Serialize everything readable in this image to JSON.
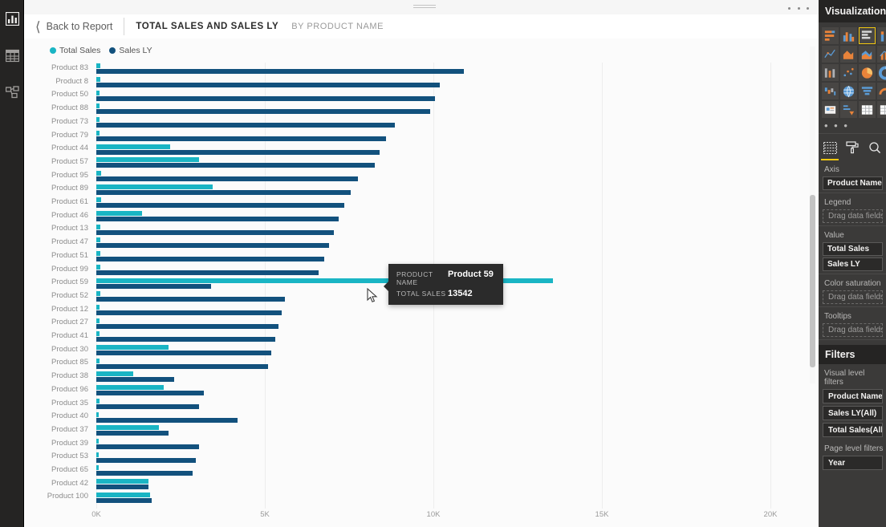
{
  "nav_rail": {
    "items": [
      {
        "name": "report-view",
        "icon": "bar-chart-icon",
        "active": true
      },
      {
        "name": "data-view",
        "icon": "table-grid-icon",
        "active": false
      },
      {
        "name": "model-view",
        "icon": "relationships-icon",
        "active": false
      }
    ]
  },
  "header": {
    "back_label": "Back to Report",
    "title": "TOTAL SALES AND SALES LY",
    "subtitle": "BY PRODUCT NAME",
    "overflow_menu": "…"
  },
  "legend": {
    "items": [
      {
        "label": "Total Sales",
        "color": "#1ab5c4"
      },
      {
        "label": "Sales LY",
        "color": "#12517d"
      }
    ]
  },
  "tooltip": {
    "key1": "PRODUCT NAME",
    "val1": "Product 59",
    "key2": "TOTAL SALES",
    "val2": "13542"
  },
  "right_panel": {
    "viz_title": "Visualizations",
    "more_glyph": "• • •",
    "tabs": [
      {
        "name": "fields-tab",
        "icon": "fields-icon",
        "active": true
      },
      {
        "name": "format-tab",
        "icon": "paint-roller-icon",
        "active": false
      },
      {
        "name": "analytics-tab",
        "icon": "magnifier-icon",
        "active": false
      }
    ],
    "wells": [
      {
        "label": "Axis",
        "chips": [
          "Product Name"
        ],
        "placeholder": null
      },
      {
        "label": "Legend",
        "chips": [],
        "placeholder": "Drag data fields here"
      },
      {
        "label": "Value",
        "chips": [
          "Total Sales",
          "Sales LY"
        ],
        "placeholder": null
      },
      {
        "label": "Color saturation",
        "chips": [],
        "placeholder": "Drag data fields here"
      },
      {
        "label": "Tooltips",
        "chips": [],
        "placeholder": "Drag data fields here"
      }
    ],
    "filters_title": "Filters",
    "visual_level_label": "Visual level filters",
    "visual_level_filters": [
      "Product Name(All)",
      "Sales LY(All)",
      "Total Sales(All)"
    ],
    "page_level_label": "Page level filters",
    "page_level_filters": [
      "Year"
    ]
  },
  "chart_data": {
    "type": "bar",
    "orientation": "horizontal",
    "title": "TOTAL SALES AND SALES LY",
    "subtitle": "BY PRODUCT NAME",
    "xlabel": "",
    "ylabel": "",
    "xlim": [
      0,
      21000
    ],
    "ticks": [
      {
        "label": "0K",
        "value": 0
      },
      {
        "label": "5K",
        "value": 5000
      },
      {
        "label": "10K",
        "value": 10000
      },
      {
        "label": "15K",
        "value": 15000
      },
      {
        "label": "20K",
        "value": 20000
      }
    ],
    "grid": true,
    "legend_position": "top-left",
    "highlighted_category": "Product 59",
    "categories": [
      "Product 83",
      "Product 8",
      "Product 50",
      "Product 88",
      "Product 73",
      "Product 79",
      "Product 44",
      "Product 57",
      "Product 95",
      "Product 89",
      "Product 61",
      "Product 46",
      "Product 13",
      "Product 47",
      "Product 51",
      "Product 99",
      "Product 59",
      "Product 52",
      "Product 12",
      "Product 27",
      "Product 41",
      "Product 30",
      "Product 85",
      "Product 38",
      "Product 96",
      "Product 35",
      "Product 40",
      "Product 37",
      "Product 39",
      "Product 53",
      "Product 65",
      "Product 42",
      "Product 100"
    ],
    "series": [
      {
        "name": "Total Sales",
        "color": "#1ab5c4",
        "values": [
          120,
          110,
          100,
          95,
          90,
          85,
          2200,
          3050,
          150,
          3450,
          140,
          1350,
          130,
          125,
          120,
          115,
          13542,
          110,
          105,
          100,
          95,
          2150,
          90,
          1100,
          2000,
          85,
          80,
          1850,
          75,
          70,
          65,
          1550,
          1600
        ]
      },
      {
        "name": "Sales LY",
        "color": "#12517d",
        "values": [
          10900,
          10200,
          10050,
          9900,
          8850,
          8600,
          8400,
          8250,
          7750,
          7550,
          7350,
          7200,
          7050,
          6900,
          6750,
          6600,
          3400,
          5600,
          5500,
          5400,
          5300,
          5200,
          5100,
          2300,
          3200,
          3050,
          4200,
          2150,
          3050,
          2950,
          2850,
          1550,
          1650
        ]
      }
    ]
  }
}
